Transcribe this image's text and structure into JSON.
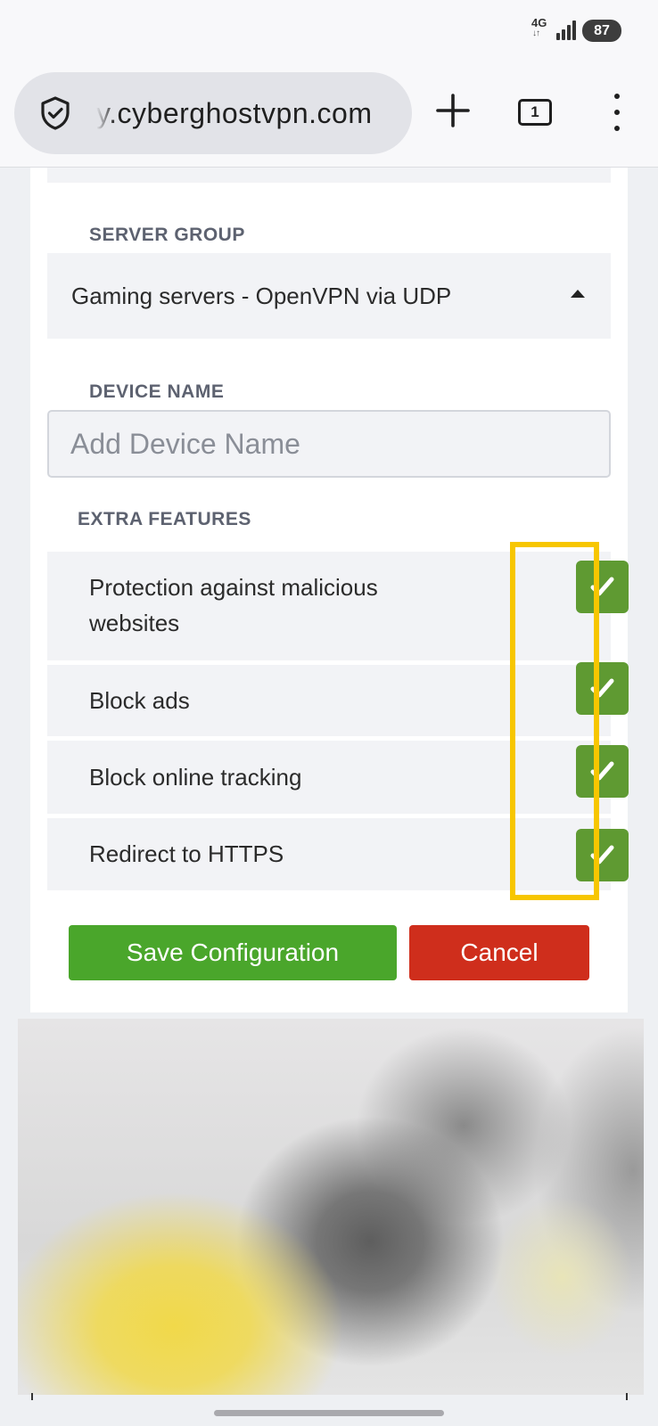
{
  "status_bar": {
    "network": "4G",
    "network_arrows": "↓↑",
    "battery": "87"
  },
  "browser": {
    "url": "y.cyberghostvpn.com",
    "tab_count": "1",
    "icons": [
      "shield-check-icon",
      "plus-icon",
      "tabs-icon",
      "more-vert-icon"
    ]
  },
  "form": {
    "server_group": {
      "label": "SERVER GROUP",
      "value": "Gaming servers - OpenVPN via UDP"
    },
    "device_name": {
      "label": "DEVICE NAME",
      "value": "",
      "placeholder": "Add Device Name"
    },
    "extra_features": {
      "label": "EXTRA FEATURES",
      "items": [
        {
          "line1": "Protection against malicious",
          "line2": "websites",
          "checked": true
        },
        {
          "line1": "Block ads",
          "checked": true
        },
        {
          "line1": "Block online tracking",
          "checked": true
        },
        {
          "line1": "Redirect to HTTPS",
          "checked": true
        }
      ]
    },
    "buttons": {
      "save": "Save Configuration",
      "cancel": "Cancel"
    }
  },
  "colors": {
    "checkbox": "#5f9a32",
    "save_button": "#4aa62b",
    "cancel_button": "#cf2e1c",
    "highlight": "#f7c600"
  }
}
